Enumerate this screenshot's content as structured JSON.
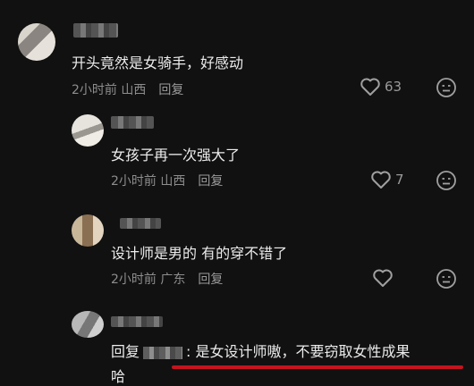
{
  "comments": [
    {
      "text": "开头竟然是女骑手，好感动",
      "meta": "2小时前 山西",
      "reply_label": "回复",
      "likes": "63"
    },
    {
      "text": "女孩子再一次强大了",
      "meta": "2小时前 山西",
      "reply_label": "回复",
      "likes": "7"
    },
    {
      "text": "设计师是男的 有的穿不错了",
      "meta": "2小时前 广东",
      "reply_label": "回复",
      "likes": ""
    }
  ],
  "last_reply": {
    "prefix": "回复",
    "text": ": 是女设计师嗷，不要窃取女性成果",
    "continuation": "哈"
  },
  "colors": {
    "background": "#111111",
    "text": "#ececec",
    "meta": "#8d8d8d",
    "underline": "#c5141e"
  },
  "icons": {
    "like": "heart-outline-icon",
    "dislike": "meh-face-icon"
  }
}
